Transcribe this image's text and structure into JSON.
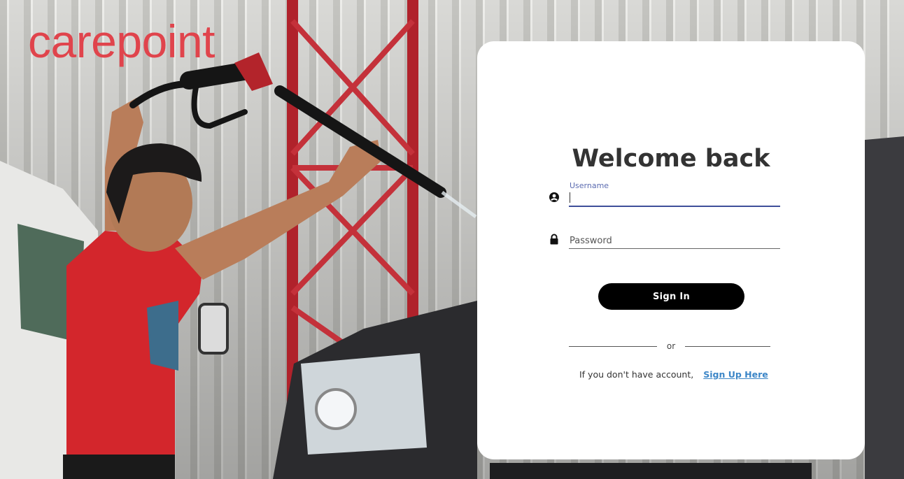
{
  "brand": {
    "name": "carepoint",
    "color": "#e0444c"
  },
  "login": {
    "title": "Welcome back",
    "username": {
      "label": "Username",
      "value": "",
      "icon": "user-icon"
    },
    "password": {
      "placeholder": "Password",
      "value": "",
      "icon": "lock-icon"
    },
    "submit_label": "Sign In",
    "divider_text": "or",
    "signup_prompt": "If you don't have account,",
    "signup_link": "Sign Up Here"
  },
  "colors": {
    "accent_link": "#3c86c7",
    "focused_field": "#3f4f9a",
    "button": "#000000",
    "card": "#ffffff"
  }
}
